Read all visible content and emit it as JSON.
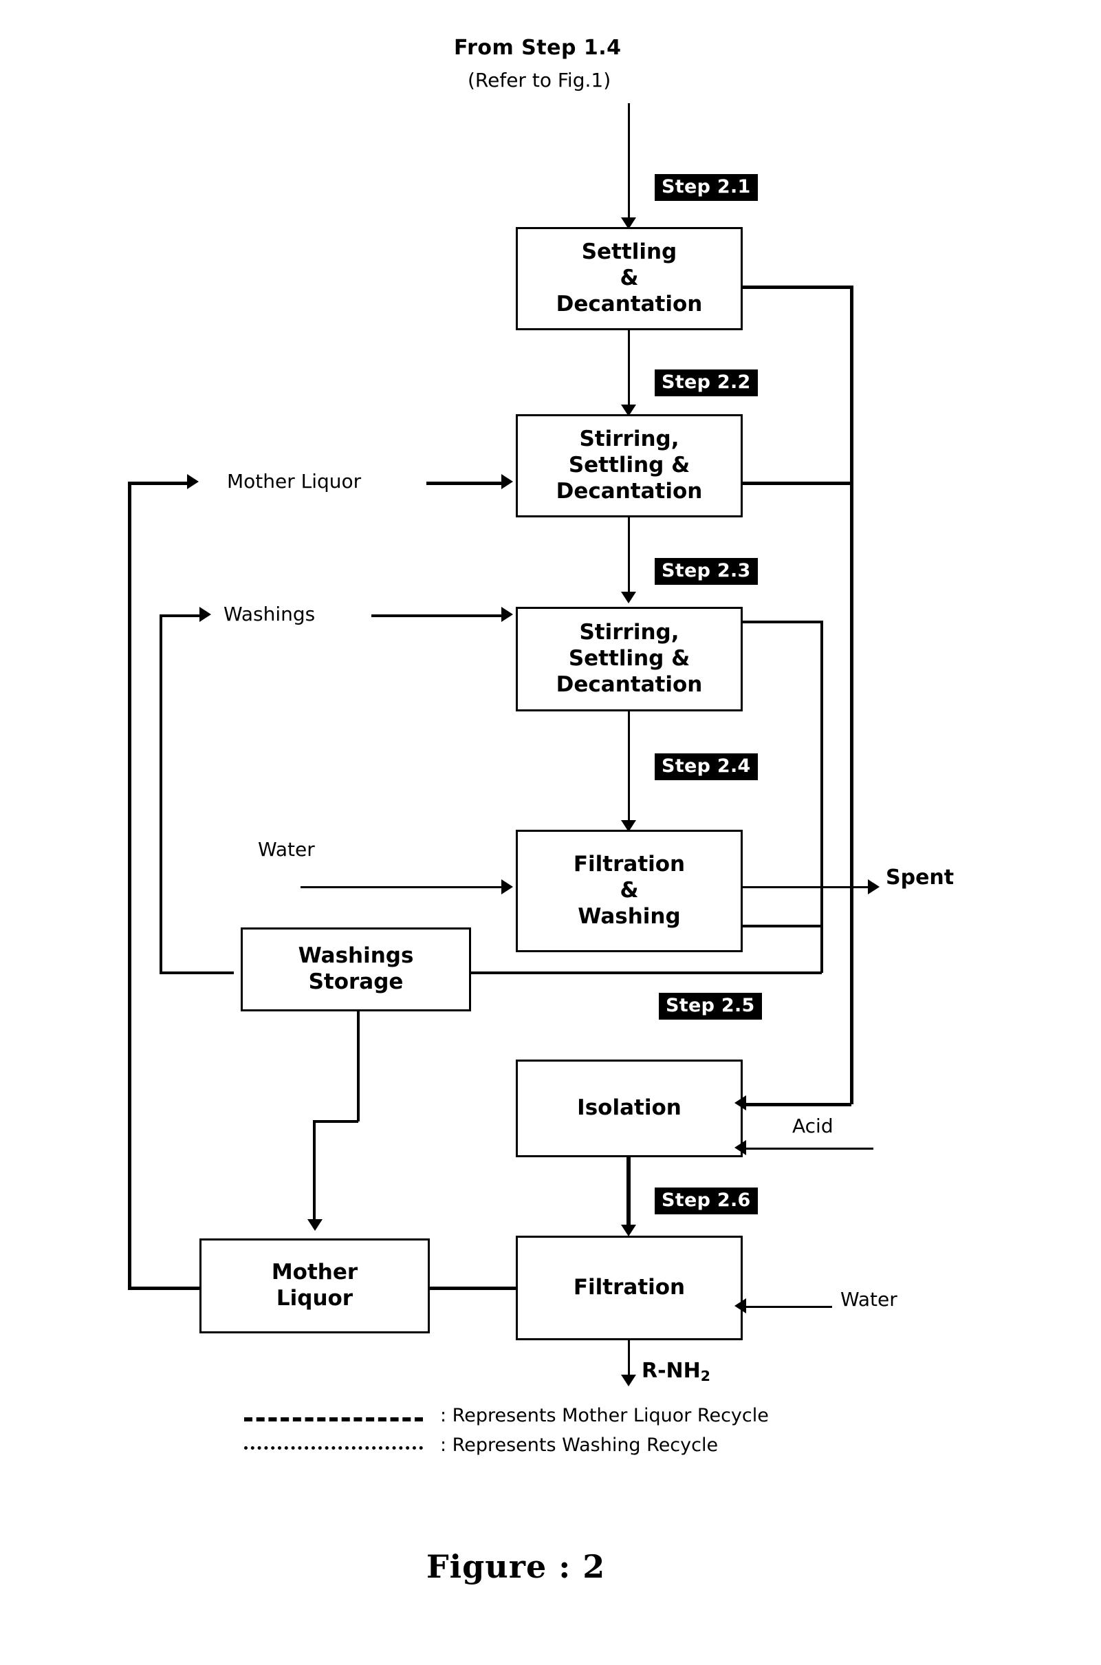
{
  "header": {
    "title": "From Step 1.4",
    "subtitle": "(Refer to Fig.1)"
  },
  "steps": [
    {
      "id": "step-2-1",
      "label": "Step 2.1"
    },
    {
      "id": "step-2-2",
      "label": "Step 2.2"
    },
    {
      "id": "step-2-3",
      "label": "Step 2.3"
    },
    {
      "id": "step-2-4",
      "label": "Step 2.4"
    },
    {
      "id": "step-2-5",
      "label": "Step 2.5"
    },
    {
      "id": "step-2-6",
      "label": "Step 2.6"
    }
  ],
  "boxes": {
    "settling_decantation": "Settling\n&\nDecantation",
    "settling_line1": "Settling",
    "settling_line2": "&",
    "settling_line3": "Decantation",
    "stirring1_line1": "Stirring,",
    "stirring1_line2": "Settling &",
    "stirring1_line3": "Decantation",
    "stirring2_line1": "Stirring,",
    "stirring2_line2": "Settling &",
    "stirring2_line3": "Decantation",
    "filtration_washing_line1": "Filtration",
    "filtration_washing_line2": "&",
    "filtration_washing_line3": "Washing",
    "washings_storage_line1": "Washings",
    "washings_storage_line2": "Storage",
    "isolation": "Isolation",
    "mother_liquor_line1": "Mother",
    "mother_liquor_line2": "Liquor",
    "filtration": "Filtration"
  },
  "stream_labels": {
    "mother_liquor": "Mother Liquor",
    "washings": "Washings",
    "water_top": "Water",
    "water_bottom": "Water",
    "spent": "Spent",
    "acid": "Acid",
    "product": "R-NH",
    "product_subscript": "2"
  },
  "legend": [
    {
      "style": "dashed",
      "text": ": Represents Mother Liquor Recycle"
    },
    {
      "style": "dotted",
      "text": ": Represents Washing Recycle"
    }
  ],
  "figure_caption": "Figure : 2",
  "colors": {
    "ink": "#000000",
    "paper": "#ffffff",
    "step_badge_bg": "#000000",
    "step_badge_fg": "#ffffff"
  }
}
